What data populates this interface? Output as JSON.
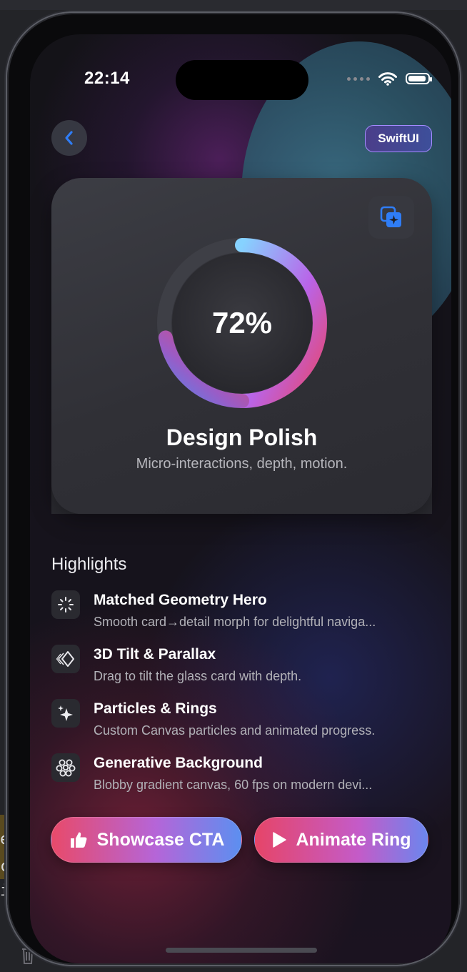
{
  "status_bar": {
    "time": "22:14"
  },
  "header": {
    "back_label": "Back",
    "badge": "SwiftUI"
  },
  "card": {
    "progress_percent": 72,
    "progress_label": "72%",
    "title": "Design Polish",
    "subtitle": "Micro-interactions, depth, motion."
  },
  "highlights": {
    "heading": "Highlights",
    "items": [
      {
        "title": "Matched Geometry Hero",
        "desc": "Smooth card→detail morph for delightful naviga...",
        "icon": "sparkle-burst-icon"
      },
      {
        "title": "3D Tilt & Parallax",
        "desc": "Drag to tilt the glass card with depth.",
        "icon": "tilt-diamond-icon"
      },
      {
        "title": "Particles & Rings",
        "desc": "Custom Canvas particles and animated progress.",
        "icon": "sparkles-icon"
      },
      {
        "title": "Generative Background",
        "desc": "Blobby gradient canvas, 60 fps on modern devi...",
        "icon": "circles-cluster-icon"
      }
    ]
  },
  "actions": {
    "showcase_label": "Showcase CTA",
    "animate_label": "Animate Ring"
  },
  "colors": {
    "accent_blue": "#2f7df6",
    "ring_start": "#7fd0ff",
    "ring_mid": "#b868e6",
    "ring_end": "#e8466a",
    "badge_border": "#a58cff"
  }
}
